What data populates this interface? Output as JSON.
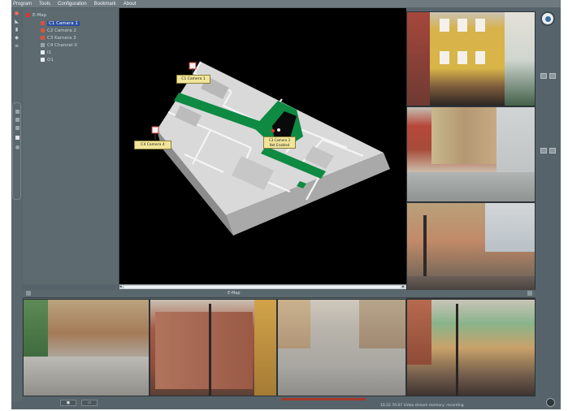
{
  "menu": [
    "Program",
    "Tools",
    "Configuration",
    "Bookmark",
    "About"
  ],
  "tree": {
    "root": "E-Map",
    "items": [
      {
        "label": "C1 Camera 1",
        "selected": true
      },
      {
        "label": "C2 Camera 2",
        "selected": false
      },
      {
        "label": "C3 Kamera 3",
        "selected": false
      },
      {
        "label": "C4 Channel 0",
        "selected": false
      },
      {
        "label": "I1",
        "selected": false
      },
      {
        "label": "O1",
        "selected": false
      }
    ]
  },
  "map": {
    "tags": [
      "C1 Camera 1",
      "C4 Camera 4",
      "C3 Camera 3\nNot Enabled"
    ]
  },
  "panels": {
    "bottom_title": "E-Map"
  },
  "status": {
    "text": "10.22.70.07   Video stream memory: recording"
  },
  "colors": {
    "window": "#56636a",
    "selected": "#2a4fa3",
    "floor": "#0e8a43",
    "tag": "#f1e59a"
  }
}
